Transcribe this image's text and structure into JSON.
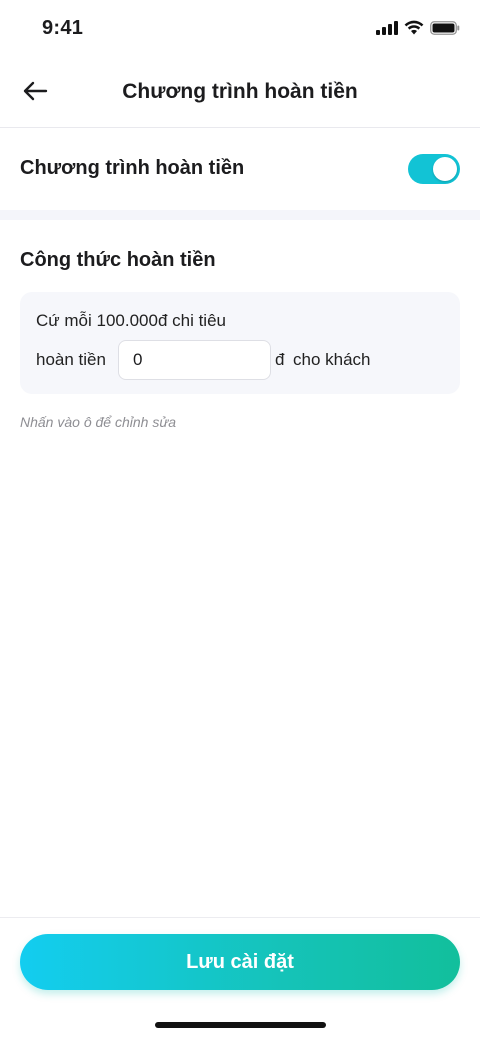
{
  "status_bar": {
    "time": "9:41",
    "icons": [
      "signal-icon",
      "wifi-icon",
      "battery-icon"
    ]
  },
  "nav": {
    "back_icon": "arrow-left-icon",
    "title": "Chương trình hoàn tiền"
  },
  "cashback_toggle": {
    "label": "Chương trình hoàn tiền",
    "enabled": true,
    "color": "#12c3d5"
  },
  "formula": {
    "title": "Công thức hoàn tiền",
    "line1": "Cứ mỗi 100.000đ chi tiêu",
    "prefix": "hoàn tiền",
    "amount_value": "0",
    "currency": "đ",
    "suffix": "cho khách",
    "hint": "Nhấn vào ô để chỉnh sửa"
  },
  "footer": {
    "save_label": "Lưu cài đặt",
    "gradient": [
      "#13cdf0",
      "#12bf9c"
    ]
  }
}
